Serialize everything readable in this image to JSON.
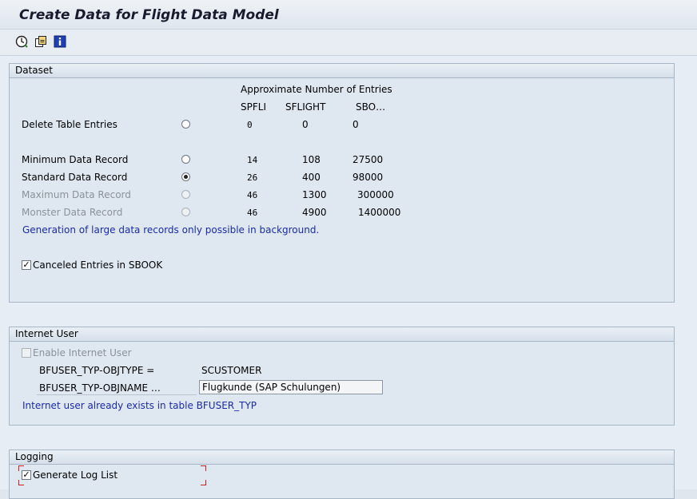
{
  "window": {
    "title": "Create Data for Flight Data Model"
  },
  "toolbar": {
    "icons": [
      "execute-icon",
      "variant-icon",
      "info-icon"
    ]
  },
  "dataset": {
    "header": "Dataset",
    "approx_label": "Approximate Number of Entries",
    "col_spfli": "SPFLI",
    "col_sflight": "SFLIGHT",
    "col_sbook": "SBO…",
    "rows": [
      {
        "label": "Delete Table Entries",
        "spfli": "0",
        "sflight": "0",
        "sbook": "0",
        "selected": false,
        "enabled": true
      },
      {
        "label": "Minimum Data Record",
        "spfli": "14",
        "sflight": "108",
        "sbook": "27500",
        "selected": false,
        "enabled": true
      },
      {
        "label": "Standard Data Record",
        "spfli": "26",
        "sflight": "400",
        "sbook": "98000",
        "selected": true,
        "enabled": true
      },
      {
        "label": "Maximum Data Record",
        "spfli": "46",
        "sflight": "1300",
        "sbook": "300000",
        "selected": false,
        "enabled": false
      },
      {
        "label": "Monster Data Record",
        "spfli": "46",
        "sflight": "4900",
        "sbook": "1400000",
        "selected": false,
        "enabled": false
      }
    ],
    "background_note": "Generation of large data records only possible in background.",
    "canceled_label": "Canceled Entries in SBOOK",
    "canceled_checked": true
  },
  "internet_user": {
    "header": "Internet User",
    "enable_label": "Enable Internet User",
    "enable_checked": false,
    "objtype_label": "BFUSER_TYP-OBJTYPE =",
    "objtype_value": "SCUSTOMER",
    "objname_label": "BFUSER_TYP-OBJNAME …",
    "objname_value": "Flugkunde (SAP Schulungen)",
    "note": "Internet user already exists in table BFUSER_TYP"
  },
  "logging": {
    "header": "Logging",
    "generate_label": "Generate Log List",
    "generate_checked": true
  }
}
